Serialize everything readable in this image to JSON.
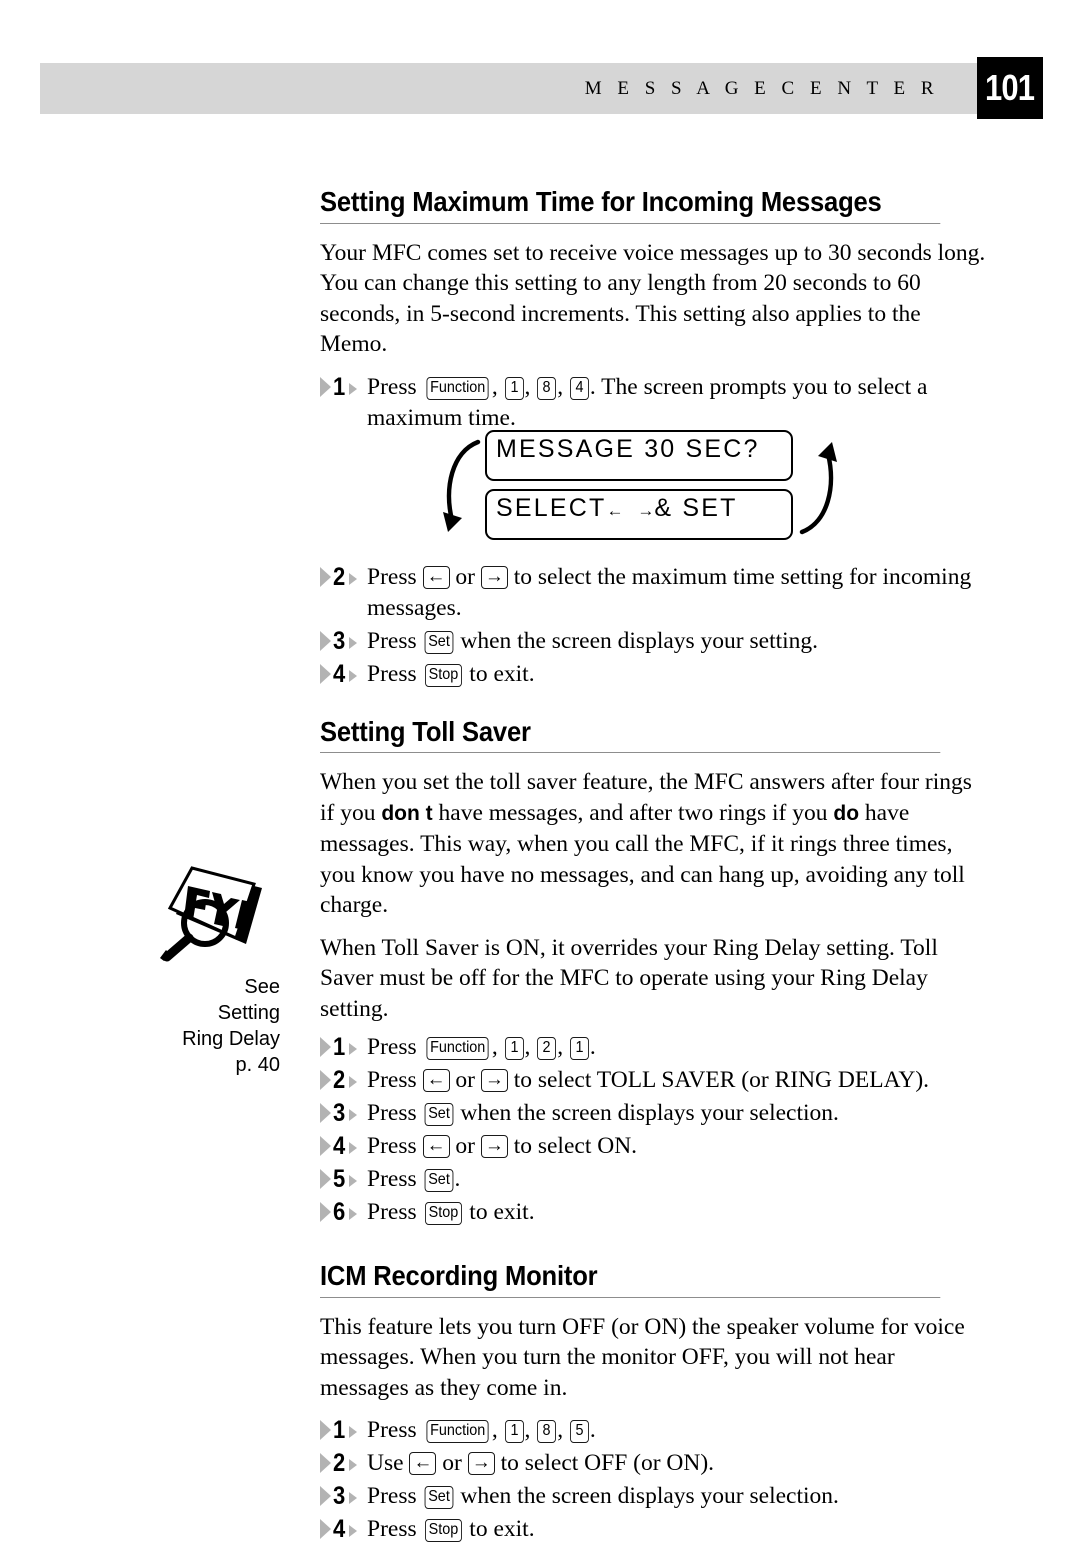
{
  "header": {
    "running_title": "M E S S A G E   C E N T E R",
    "page_number": "101",
    "band_color": "#d6d6d6",
    "page_box_color": "#000000"
  },
  "sections": [
    {
      "heading": "Setting Maximum Time for Incoming Messages",
      "paragraphs": [
        "Your MFC comes set to receive voice messages up to 30 seconds long. You can change this setting to any length from 20 seconds to 60 seconds, in 5-second increments. This setting also applies to the Memo."
      ],
      "steps": [
        {
          "num": "1",
          "pre": "Press ",
          "keys": [
            "Function",
            "1",
            "8",
            "4"
          ],
          "post": ".  The screen prompts you to select a maximum time."
        },
        {
          "num": "2",
          "pre": "Press ",
          "arrow_pair": true,
          "post": " to select the maximum time setting for incoming messages."
        },
        {
          "num": "3",
          "pre": "Press ",
          "keys": [
            "Set"
          ],
          "post": " when the screen displays your setting."
        },
        {
          "num": "4",
          "pre": "Press ",
          "keys": [
            "Stop"
          ],
          "post": " to exit."
        }
      ],
      "lcd": {
        "line1": "MESSAGE 30 SEC?",
        "line2_before": "SELECT",
        "line2_left_arrow": "←",
        "line2_right_arrow": "→",
        "line2_after": "& SET",
        "left_arrow_direction": "down",
        "right_arrow_direction": "up"
      }
    },
    {
      "heading": "Setting Toll Saver",
      "paragraphs": [
        "When you set the toll saver feature, the MFC answers after four rings if you ",
        "When Toll Saver is ON, it overrides your Ring Delay setting. Toll Saver must be off for the MFC to operate using your Ring Delay setting."
      ],
      "para1_parts": {
        "a": "When you set the toll saver feature, the MFC answers after four rings if you ",
        "bold1": "don t",
        "b": " have messages, and after two rings if you ",
        "bold2": "do",
        "c": " have messages. This way, when you call the MFC, if it rings three times, you know you have no messages, and can hang up, avoiding any toll charge."
      },
      "steps": [
        {
          "num": "1",
          "pre": "Press ",
          "keys": [
            "Function",
            "1",
            "2",
            "1"
          ],
          "post": "."
        },
        {
          "num": "2",
          "pre": "Press ",
          "arrow_pair": true,
          "post": " to select TOLL SAVER (or RING DELAY)."
        },
        {
          "num": "3",
          "pre": "Press ",
          "keys": [
            "Set"
          ],
          "post": " when the screen displays your selection."
        },
        {
          "num": "4",
          "pre": "Press ",
          "arrow_pair": true,
          "post": " to select ON."
        },
        {
          "num": "5",
          "pre": "Press ",
          "keys": [
            "Set"
          ],
          "post": "."
        },
        {
          "num": "6",
          "pre": "Press ",
          "keys": [
            "Stop"
          ],
          "post": " to exit."
        }
      ]
    },
    {
      "heading": "ICM Recording Monitor",
      "paragraphs": [
        "This feature lets you turn OFF (or ON) the speaker volume for voice messages. When you turn the monitor OFF, you will not hear messages as they come in."
      ],
      "steps": [
        {
          "num": "1",
          "pre": "Press ",
          "keys": [
            "Function",
            "1",
            "8",
            "5"
          ],
          "post": "."
        },
        {
          "num": "2",
          "pre": "Use ",
          "arrow_pair": true,
          "post": " to select OFF (or ON)."
        },
        {
          "num": "3",
          "pre": "Press ",
          "keys": [
            "Set"
          ],
          "post": " when the screen displays your selection."
        },
        {
          "num": "4",
          "pre": "Press ",
          "keys": [
            "Stop"
          ],
          "post": " to exit."
        }
      ]
    }
  ],
  "margin_note": {
    "icon_label": "FYI",
    "caption_lines": [
      "See",
      "Setting",
      "Ring Delay",
      "p. 40"
    ]
  },
  "keys": {
    "function": "Function",
    "set": "Set",
    "stop": "Stop",
    "left_arrow": "←",
    "right_arrow": "→",
    "or": " or "
  }
}
